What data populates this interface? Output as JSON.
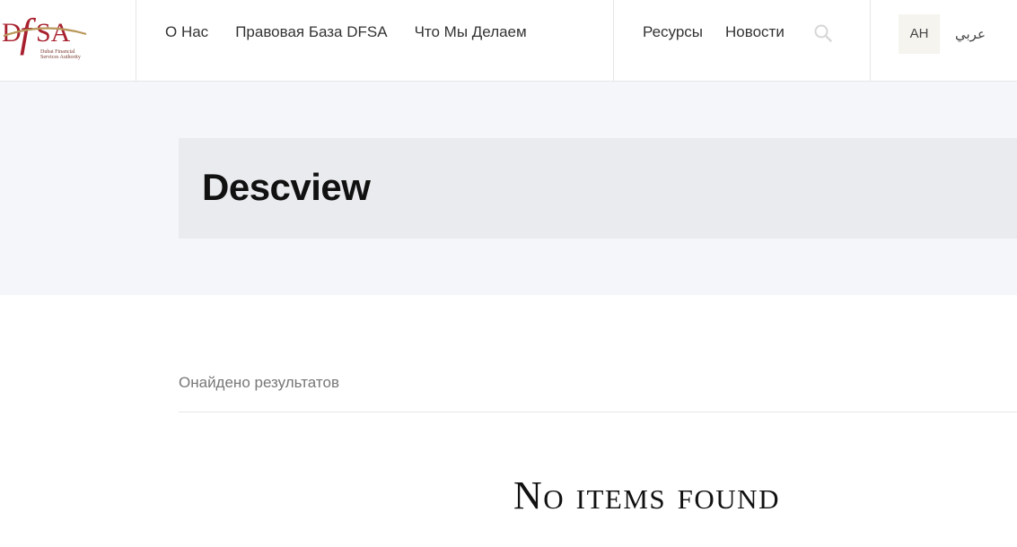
{
  "header": {
    "logo": {
      "mark": "DFSA",
      "subtitle_line1": "Dubai Financial",
      "subtitle_line2": "Services Authority",
      "color_primary": "#a8202e",
      "color_accent": "#b8975a"
    },
    "nav_left": [
      {
        "label": "О Нас"
      },
      {
        "label": "Правовая База DFSA"
      },
      {
        "label": "Что Мы Делаем"
      }
    ],
    "nav_right": [
      {
        "label": "Ресурсы"
      },
      {
        "label": "Новости"
      }
    ],
    "search_icon": "search-icon",
    "lang_current": "АН",
    "lang_alt": "عربي"
  },
  "hero": {
    "title": "Descview"
  },
  "results": {
    "count_label": "Онайдено результатов",
    "empty_message": "No items found"
  },
  "colors": {
    "hero_bg": "#f5f6fa",
    "card_bg": "#eaebef",
    "lang_bg": "#f5f4ef"
  }
}
